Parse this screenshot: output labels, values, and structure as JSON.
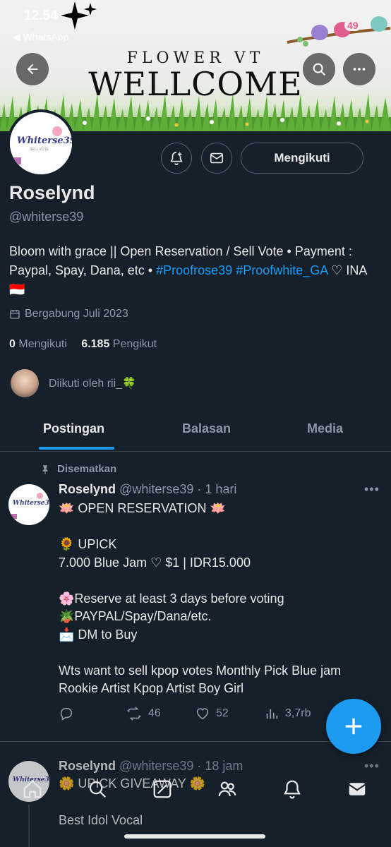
{
  "status_bar": {
    "time": "12.54",
    "back_app": "◀ WhatsApp"
  },
  "banner": {
    "line1": "FLOWER VT",
    "line2": "WELLCOME",
    "badge": "49"
  },
  "profile": {
    "avatar_text": "Whiterse39",
    "avatar_subtext": "SELL VOTE",
    "name": "Roselynd",
    "handle": "@whiterse39",
    "bio_text1": "Bloom with grace || Open Reservation / Sell Vote • Payment : Paypal, Spay, Dana, etc • ",
    "bio_tag1": "#Proofrose39",
    "bio_tag2": "#Proofwhite_GA",
    "bio_text2": " ♡ INA 🇮🇩",
    "joined": "Bergabung Juli 2023",
    "following_count": "0",
    "following_label": "Mengikuti",
    "followers_count": "6.185",
    "followers_label": "Pengikut",
    "followed_by": "Diikuti oleh rii_🍀",
    "follow_button": "Mengikuti"
  },
  "tabs": [
    {
      "label": "Postingan",
      "active": true
    },
    {
      "label": "Balasan",
      "active": false
    },
    {
      "label": "Media",
      "active": false
    }
  ],
  "posts": [
    {
      "pinned_label": "Disematkan",
      "name": "Roselynd",
      "meta": "@whiterse39 · 1 hari",
      "text": "🪷 OPEN RESERVATION 🪷\n\n🌻 UPICK\n7.000 Blue Jam ♡ $1 | IDR15.000\n\n🌸Reserve at least 3 days before voting\n🪴PAYPAL/Spay/Dana/etc.\n📩 DM to Buy\n\nWts want to sell kpop votes Monthly Pick Blue jam Rookie Artist Kpop Artist Boy Girl",
      "reposts": "46",
      "likes": "52",
      "views": "3,7rb"
    },
    {
      "name": "Roselynd",
      "meta": "@whiterse39 · 18 jam",
      "line1": "🌼 UPICK GIVEAWAY 🌼",
      "line2": "Best Idol Vocal"
    }
  ],
  "colors": {
    "accent": "#1d9bf0",
    "background": "#15202b",
    "muted": "#8b98a5",
    "border": "#38444d"
  }
}
